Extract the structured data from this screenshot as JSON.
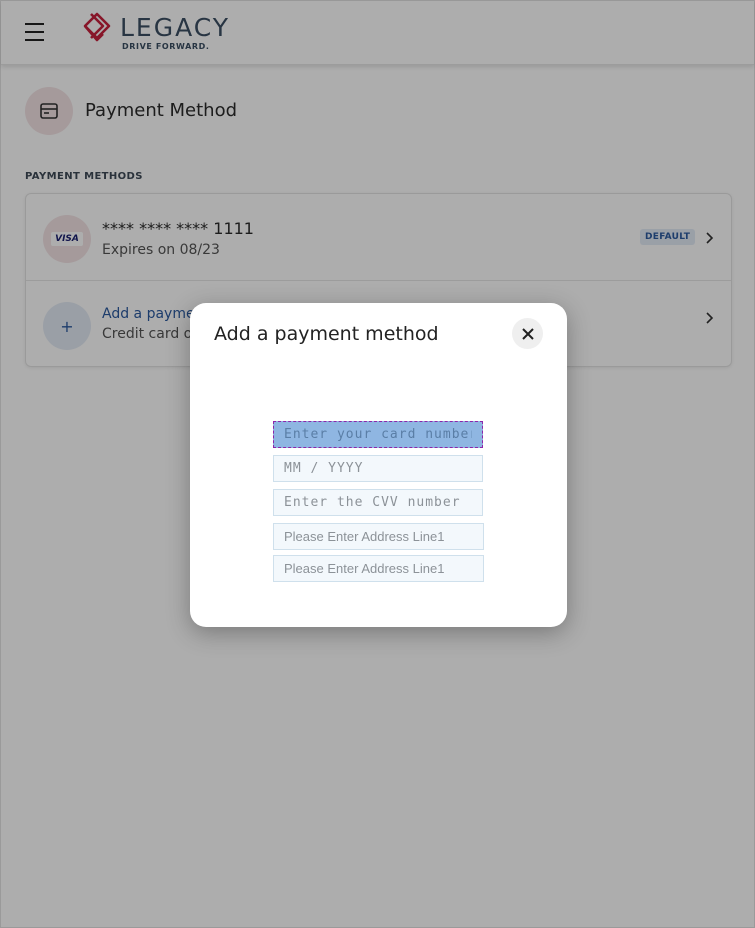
{
  "header": {
    "logo_word": "LEGACY",
    "logo_tagline": "DRIVE FORWARD.",
    "brand_color": "#c8213d"
  },
  "page": {
    "title": "Payment Method",
    "section_label": "PAYMENT METHODS"
  },
  "cards": [
    {
      "brand": "VISA",
      "number": "**** **** **** 1111",
      "expiry": "Expires on 08/23",
      "badge": "DEFAULT"
    }
  ],
  "add_method": {
    "icon": "+",
    "title": "Add a payment method",
    "subtitle": "Credit card or debit card"
  },
  "modal": {
    "title": "Add a payment method",
    "fields": {
      "card_number_placeholder": "Enter your card number",
      "expiry_placeholder": "MM / YYYY",
      "cvv_placeholder": "Enter the CVV number",
      "address1_placeholder": "Please Enter Address Line1",
      "address2_placeholder": "Please Enter Address Line1"
    }
  }
}
